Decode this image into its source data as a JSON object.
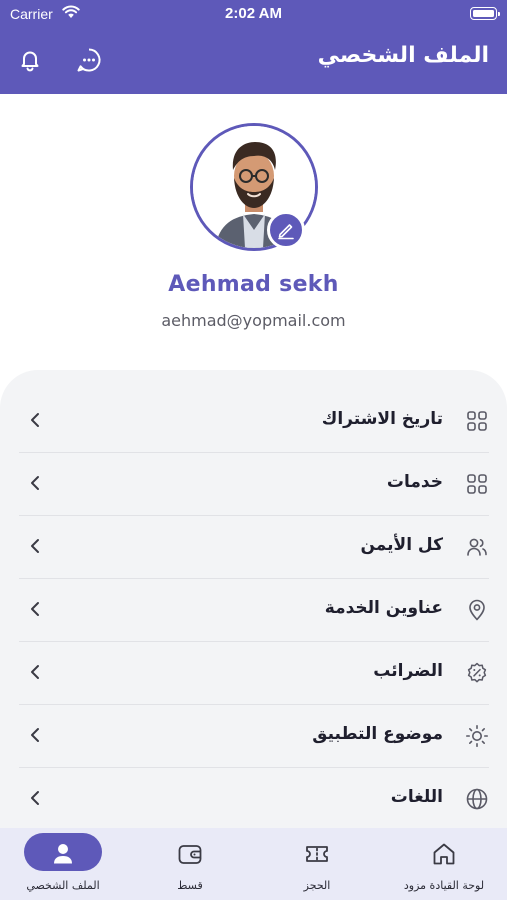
{
  "status_bar": {
    "carrier": "Carrier",
    "time": "2:02 AM"
  },
  "header": {
    "title": "الملف الشخصي",
    "icons": [
      "bell-icon",
      "chat-bubble-icon"
    ]
  },
  "profile": {
    "name": "Aehmad sekh",
    "email": "aehmad@yopmail.com",
    "edit_icon": "pencil-icon"
  },
  "menu": {
    "items": [
      {
        "label": "تاريخ الاشتراك",
        "icon": "grid-icon"
      },
      {
        "label": "خدمات",
        "icon": "grid-icon"
      },
      {
        "label": "كل الأيمن",
        "icon": "users-icon"
      },
      {
        "label": "عناوين الخدمة",
        "icon": "location-pin-icon"
      },
      {
        "label": "الضرائب",
        "icon": "tax-percent-icon"
      },
      {
        "label": "موضوع التطبيق",
        "icon": "sun-icon"
      },
      {
        "label": "اللغات",
        "icon": "globe-icon"
      }
    ]
  },
  "tabbar": {
    "tabs": [
      {
        "label": "الملف الشخصي",
        "icon": "profile-icon",
        "active": true
      },
      {
        "label": "قسط",
        "icon": "wallet-icon",
        "active": false
      },
      {
        "label": "الحجز",
        "icon": "ticket-icon",
        "active": false
      },
      {
        "label": "لوحة القيادة مزود",
        "icon": "home-icon",
        "active": false
      }
    ]
  },
  "colors": {
    "primary": "#5e59b9",
    "panel": "#f3f4f6",
    "tabbar": "#e9eaf7"
  }
}
